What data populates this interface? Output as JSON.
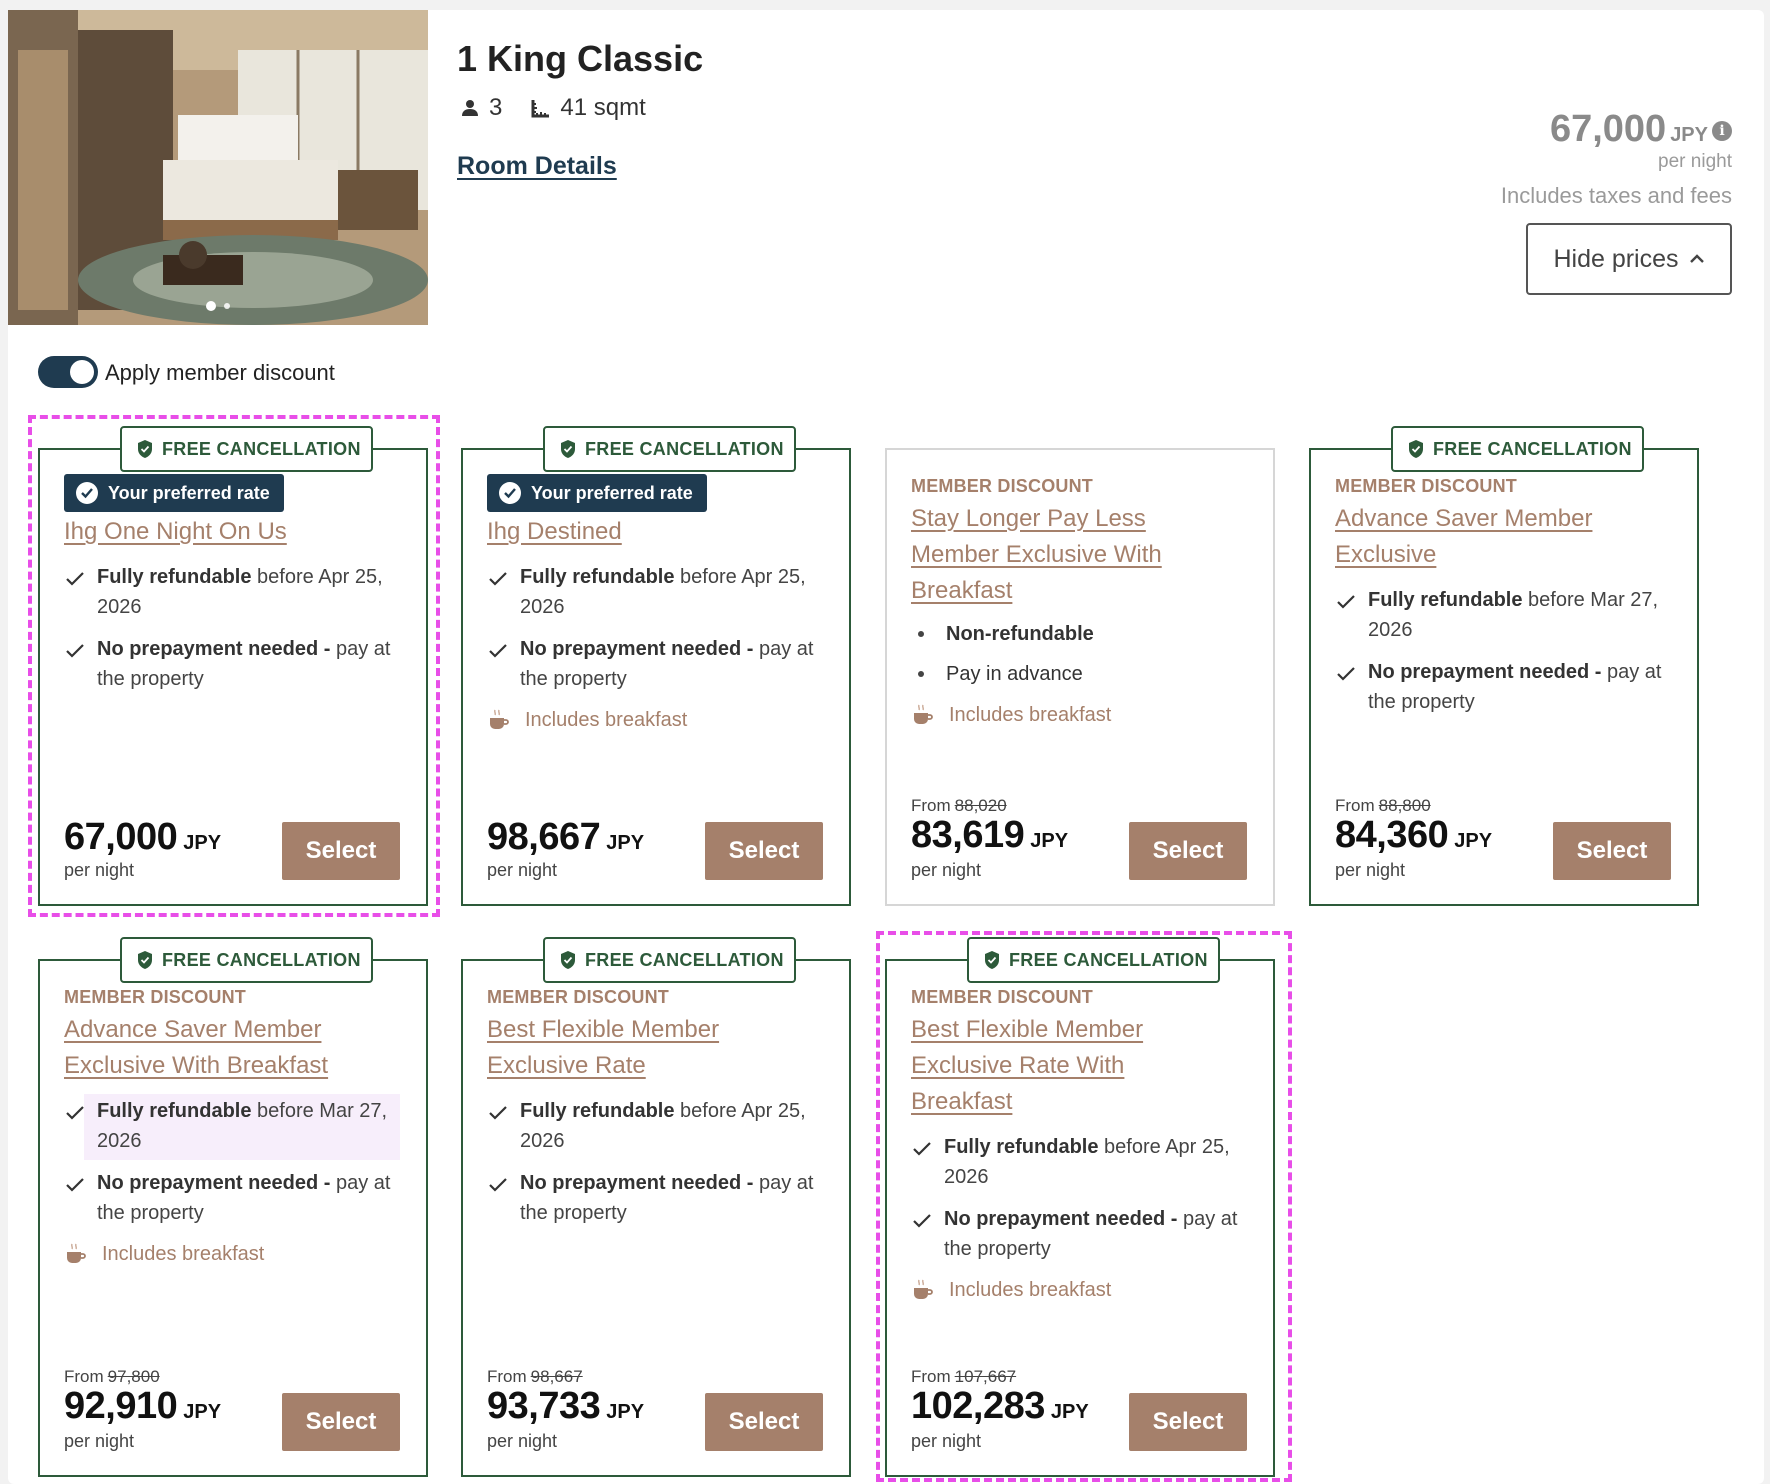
{
  "room": {
    "title": "1 King Classic",
    "guests": "3",
    "size": "41 sqmt",
    "details_link": "Room Details"
  },
  "header_price": {
    "amount": "67,000",
    "currency": "JPY",
    "per_night": "per night",
    "taxes_note": "Includes taxes and fees",
    "hide_prices_label": "Hide prices"
  },
  "member_toggle": {
    "label": "Apply member discount",
    "on": true
  },
  "colors": {
    "navy": "#1f3b50",
    "green": "#2d5a3a",
    "tan": "#a5806b",
    "highlight": "#e84ee8"
  },
  "cards": [
    {
      "badge": "FREE CANCELLATION",
      "preferred": "Your preferred rate",
      "rate_name": "Ihg One Night On Us",
      "features": [
        {
          "bold": "Fully refundable",
          "text": "before Apr 25, 2026"
        },
        {
          "bold": "No prepayment needed -",
          "text": "pay at the property"
        }
      ],
      "price": "67,000",
      "currency": "JPY",
      "per": "per night",
      "select": "Select"
    },
    {
      "badge": "FREE CANCELLATION",
      "preferred": "Your preferred rate",
      "rate_name": "Ihg Destined",
      "features": [
        {
          "bold": "Fully refundable",
          "text": "before Apr 25, 2026"
        },
        {
          "bold": "No prepayment needed -",
          "text": "pay at the property"
        }
      ],
      "breakfast": "Includes breakfast",
      "price": "98,667",
      "currency": "JPY",
      "per": "per night",
      "select": "Select"
    },
    {
      "member_tag": "MEMBER DISCOUNT",
      "rate_name": "Stay Longer Pay Less Member Exclusive With Breakfast",
      "bullets": [
        "Non-refundable",
        "Pay in advance"
      ],
      "breakfast": "Includes breakfast",
      "from": "From",
      "original": "88,020",
      "price": "83,619",
      "currency": "JPY",
      "per": "per night",
      "select": "Select"
    },
    {
      "badge": "FREE CANCELLATION",
      "member_tag": "MEMBER DISCOUNT",
      "rate_name": "Advance Saver Member Exclusive",
      "features": [
        {
          "bold": "Fully refundable",
          "text": "before Mar 27, 2026"
        },
        {
          "bold": "No prepayment needed -",
          "text": "pay at the property"
        }
      ],
      "from": "From",
      "original": "88,800",
      "price": "84,360",
      "currency": "JPY",
      "per": "per night",
      "select": "Select"
    },
    {
      "badge": "FREE CANCELLATION",
      "member_tag": "MEMBER DISCOUNT",
      "rate_name": "Advance Saver Member Exclusive With Breakfast",
      "features": [
        {
          "bold": "Fully refundable",
          "text": "before Mar 27, 2026"
        },
        {
          "bold": "No prepayment needed -",
          "text": "pay at the property"
        }
      ],
      "breakfast": "Includes breakfast",
      "from": "From",
      "original": "97,800",
      "price": "92,910",
      "currency": "JPY",
      "per": "per night",
      "select": "Select"
    },
    {
      "badge": "FREE CANCELLATION",
      "member_tag": "MEMBER DISCOUNT",
      "rate_name": "Best Flexible Member Exclusive Rate",
      "features": [
        {
          "bold": "Fully refundable",
          "text": "before Apr 25, 2026"
        },
        {
          "bold": "No prepayment needed -",
          "text": "pay at the property"
        }
      ],
      "from": "From",
      "original": "98,667",
      "price": "93,733",
      "currency": "JPY",
      "per": "per night",
      "select": "Select"
    },
    {
      "badge": "FREE CANCELLATION",
      "member_tag": "MEMBER DISCOUNT",
      "rate_name": "Best Flexible Member Exclusive Rate With Breakfast",
      "features": [
        {
          "bold": "Fully refundable",
          "text": "before Apr 25, 2026"
        },
        {
          "bold": "No prepayment needed -",
          "text": "pay at the property"
        }
      ],
      "breakfast": "Includes breakfast",
      "from": "From",
      "original": "107,667",
      "price": "102,283",
      "currency": "JPY",
      "per": "per night",
      "select": "Select"
    }
  ]
}
